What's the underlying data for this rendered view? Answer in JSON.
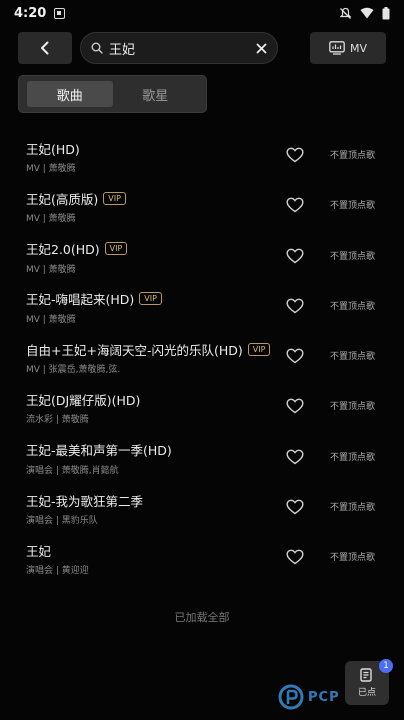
{
  "status_bar": {
    "time": "4:20"
  },
  "top_bar": {
    "search_value": "王妃",
    "mv_label": "MV"
  },
  "tabs": [
    {
      "label": "歌曲",
      "active": true
    },
    {
      "label": "歌星",
      "active": false
    }
  ],
  "songs": [
    {
      "title": "王妃(HD)",
      "vip": false,
      "sub": "MV | 萧敬腾",
      "action": "不置顶点歌"
    },
    {
      "title": "王妃(高质版)",
      "vip": true,
      "sub": "MV | 萧敬腾",
      "action": "不置顶点歌"
    },
    {
      "title": "王妃2.0(HD)",
      "vip": true,
      "sub": "MV | 萧敬腾",
      "action": "不置顶点歌"
    },
    {
      "title": "王妃-嗨唱起来(HD)",
      "vip": true,
      "sub": "MV | 萧敬腾",
      "action": "不置顶点歌"
    },
    {
      "title": "自由+王妃+海阔天空-闪光的乐队(HD)",
      "vip": true,
      "sub": "MV | 张震岳,萧敬腾,弦.",
      "action": "不置顶点歌"
    },
    {
      "title": "王妃(DJ耀仔版)(HD)",
      "vip": false,
      "sub": "流水彩 | 萧敬腾",
      "action": "不置顶点歌"
    },
    {
      "title": "王妃-最美和声第一季(HD)",
      "vip": false,
      "sub": "演唱会 | 萧敬腾,肖懿航",
      "action": "不置顶点歌"
    },
    {
      "title": "王妃-我为歌狂第二季",
      "vip": false,
      "sub": "演唱会 | 黑豹乐队",
      "action": "不置顶点歌"
    },
    {
      "title": "王妃",
      "vip": false,
      "sub": "演唱会 | 黄迎迎",
      "action": "不置顶点歌"
    }
  ],
  "vip_label": "VIP",
  "footer": {
    "loaded_all": "已加载全部"
  },
  "ordered_button": {
    "label": "已点",
    "count": "1"
  },
  "watermark": {
    "text": "PCP"
  },
  "colors": {
    "background": "#050505",
    "vip": "#d8b878",
    "badge": "#4c6ef5",
    "watermark": "#3a8fd6"
  }
}
